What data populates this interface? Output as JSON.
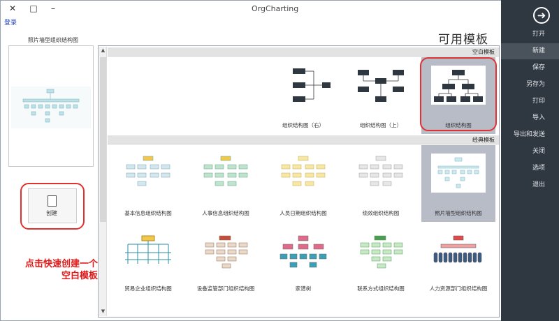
{
  "window": {
    "title": "OrgCharting",
    "close_glyph": "✕",
    "restore_glyph": "□",
    "minimize_glyph": "–"
  },
  "top_link": "登录",
  "sidebar": {
    "items": [
      {
        "label": "打开",
        "active": false
      },
      {
        "label": "新建",
        "active": true
      },
      {
        "label": "保存",
        "active": false
      },
      {
        "label": "另存为",
        "active": false
      },
      {
        "label": "打印",
        "active": false
      },
      {
        "label": "导入",
        "active": false
      },
      {
        "label": "导出和发送",
        "active": false
      },
      {
        "label": "关闭",
        "active": false
      },
      {
        "label": "选项",
        "active": false
      },
      {
        "label": "退出",
        "active": false
      }
    ]
  },
  "main": {
    "title": "可用模板",
    "preview_caption": "照片墙型组织结构图",
    "create_label": "创建",
    "hint": "点击快速创建一个空白模板"
  },
  "templates": {
    "blank_section": "空白模板",
    "classic_section": "经典模板",
    "blank": [
      "组织结构图",
      "组织结构图（上）",
      "组织结构图（右）"
    ],
    "classic_row1": [
      "照片墙型组织结构图",
      "绩效组织结构图",
      "人员日期组织结构图",
      "人事信息组织结构图",
      "基本信息组织结构图"
    ],
    "classic_row2": [
      "人力资源部门组织结构图",
      "联系方式组织结构图",
      "家谱树",
      "设备监管部门组织结构图",
      "贸易企业组织结构图"
    ]
  },
  "colors": {
    "sidebar": "#2f3740",
    "accent_red": "#e01818",
    "selected": "#b7bcc7"
  }
}
